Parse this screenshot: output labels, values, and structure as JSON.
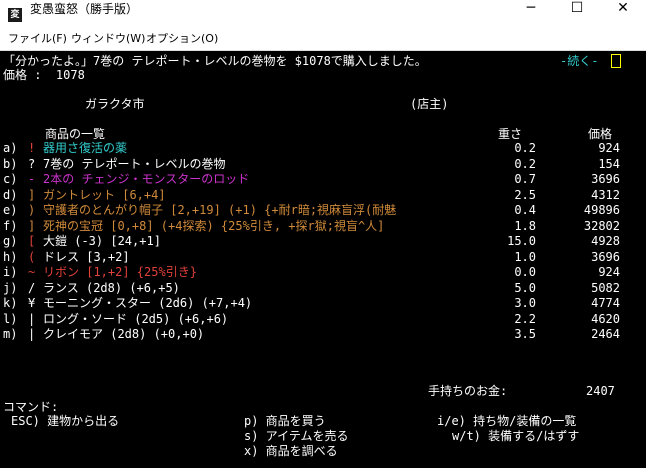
{
  "window": {
    "title": "変愚蛮怒（勝手版）",
    "icon_label": "変",
    "controls": {
      "minimize": "─",
      "maximize": "☐",
      "close": "✕"
    }
  },
  "menu": [
    "ファイル(F)",
    "ウィンドウ(W)",
    "オプション(O)"
  ],
  "message": {
    "text": "「分かったよ。」7巻の テレポート・レベルの巻物を $1078で購入しました。",
    "more": "-続く-"
  },
  "price_prompt": "価格 :  1078",
  "shop": {
    "name": "ガラクタ市",
    "owner": "(店主)"
  },
  "headers": {
    "list": "商品の一覧",
    "weight": "重さ",
    "price": "価格"
  },
  "colors": {
    "white": "#ffffff",
    "cyan": "#33cccc",
    "magenta": "#cc33cc",
    "orange": "#d08a3a",
    "red": "#e0413a",
    "yellow": "#ffff00"
  },
  "items": [
    {
      "label": "a)",
      "symbol": "!",
      "name": "器用さ復活の薬",
      "weight": "0.2",
      "price": "924",
      "symbol_color": "#e0413a",
      "name_color": "#33cccc"
    },
    {
      "label": "b)",
      "symbol": "?",
      "name": "7巻の テレポート・レベルの巻物",
      "weight": "0.2",
      "price": "154",
      "symbol_color": "#ffffff",
      "name_color": "#ffffff"
    },
    {
      "label": "c)",
      "symbol": "-",
      "name": "2本の チェンジ・モンスターのロッド",
      "weight": "0.7",
      "price": "3696",
      "symbol_color": "#cc33cc",
      "name_color": "#cc33cc"
    },
    {
      "label": "d)",
      "symbol": "]",
      "name": "ガントレット [6,+4]",
      "weight": "2.5",
      "price": "4312",
      "symbol_color": "#d08a3a",
      "name_color": "#d08a3a"
    },
    {
      "label": "e)",
      "symbol": ")",
      "name": "守護者のとんがり帽子 [2,+19] (+1) {+耐r暗;視麻盲浮(耐魅",
      "weight": "0.4",
      "price": "49896",
      "symbol_color": "#d08a3a",
      "name_color": "#d08a3a"
    },
    {
      "label": "f)",
      "symbol": "]",
      "name": "死神の宝冠 [0,+8] (+4探索) {25%引き, +探r獄;視盲^人]",
      "weight": "1.8",
      "price": "32802",
      "symbol_color": "#d08a3a",
      "name_color": "#d08a3a"
    },
    {
      "label": "g)",
      "symbol": "[",
      "name": "大鎧 (-3) [24,+1]",
      "weight": "15.0",
      "price": "4928",
      "symbol_color": "#e0413a",
      "name_color": "#ffffff"
    },
    {
      "label": "h)",
      "symbol": "(",
      "name": "ドレス [3,+2]",
      "weight": "1.0",
      "price": "3696",
      "symbol_color": "#e0413a",
      "name_color": "#ffffff"
    },
    {
      "label": "i)",
      "symbol": "~",
      "name": "リボン [1,+2] {25%引き}",
      "weight": "0.0",
      "price": "924",
      "symbol_color": "#e0413a",
      "name_color": "#e0413a"
    },
    {
      "label": "j)",
      "symbol": "/",
      "name": "ランス (2d8) (+6,+5)",
      "weight": "5.0",
      "price": "5082",
      "symbol_color": "#ffffff",
      "name_color": "#ffffff"
    },
    {
      "label": "k)",
      "symbol": "¥",
      "name": "モーニング・スター (2d6) (+7,+4)",
      "weight": "3.0",
      "price": "4774",
      "symbol_color": "#ffffff",
      "name_color": "#ffffff"
    },
    {
      "label": "l)",
      "symbol": "|",
      "name": "ロング・ソード (2d5) (+6,+6)",
      "weight": "2.2",
      "price": "4620",
      "symbol_color": "#ffffff",
      "name_color": "#ffffff"
    },
    {
      "label": "m)",
      "symbol": "|",
      "name": "クレイモア (2d8) (+0,+0)",
      "weight": "3.5",
      "price": "2464",
      "symbol_color": "#ffffff",
      "name_color": "#ffffff"
    }
  ],
  "gold": {
    "label": "手持ちのお金:",
    "value": "2407"
  },
  "commands": {
    "title": "コマンド:",
    "exit": "ESC) 建物から出る",
    "purchase": "p) 商品を買う",
    "steal": "s) アイテムを売る",
    "examine": "x) 商品を調べる",
    "inventory": "i/e) 持ち物/装備の一覧",
    "wield": "w/t) 装備する/はずす"
  }
}
